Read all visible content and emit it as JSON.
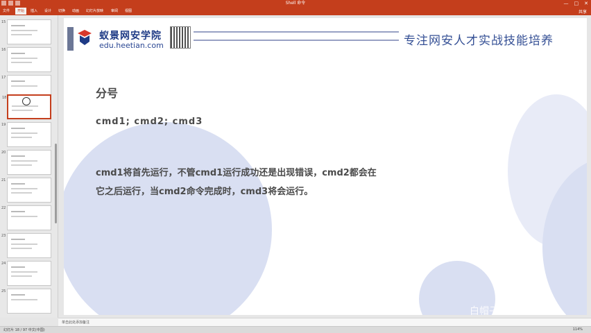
{
  "window": {
    "title": "Shell 命令",
    "controls": [
      "—",
      "□",
      "✕"
    ]
  },
  "ribbon": {
    "tabs": [
      "文件",
      "开始",
      "插入",
      "设计",
      "切换",
      "动画",
      "幻灯片放映",
      "审阅",
      "视图"
    ],
    "active_index": 1,
    "share": "共享"
  },
  "thumbnails": [
    {
      "num": "15"
    },
    {
      "num": "16"
    },
    {
      "num": "17"
    },
    {
      "num": "18"
    },
    {
      "num": "19"
    },
    {
      "num": "20"
    },
    {
      "num": "21"
    },
    {
      "num": "22"
    },
    {
      "num": "23"
    },
    {
      "num": "24"
    },
    {
      "num": "25"
    }
  ],
  "selected_thumbnail": 3,
  "slide": {
    "logo_cn": "蚁景网安学院",
    "logo_en": "edu.heetian.com",
    "slogan": "专注网安人才实战技能培养",
    "heading": "分号",
    "command": "cmd1; cmd2; cmd3",
    "paragraph_line1": "cmd1将首先运行，不管cmd1运行成功还是出现错误，cmd2都会在",
    "paragraph_line2": "它之后运行，当cmd2命令完成时，cmd3将会运行。",
    "watermark": "白帽子 攻防 @ 小学"
  },
  "notes_placeholder": "单击此处添加备注",
  "status": {
    "left": "幻灯片 18 / 97   中文(中国)",
    "zoom": "114%"
  },
  "colors": {
    "accent": "#c43e1c",
    "brand": "#1f3b86",
    "deco": "#d9dff2"
  }
}
